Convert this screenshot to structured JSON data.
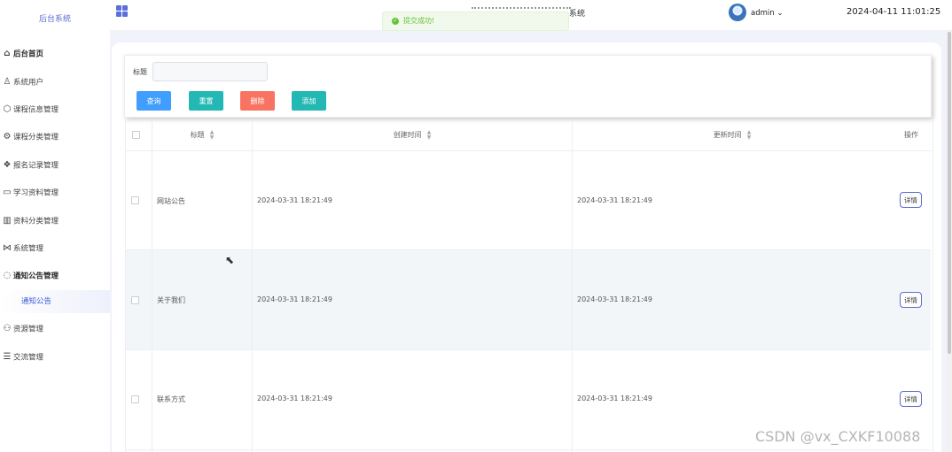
{
  "sidebar": {
    "brand": "后台系统",
    "items": [
      {
        "label": "后台首页",
        "icon": "home-icon",
        "glyph": "⌂"
      },
      {
        "label": "系统用户",
        "icon": "user-icon",
        "glyph": "♙"
      },
      {
        "label": "课程信息管理",
        "icon": "cube-icon",
        "glyph": "⬡"
      },
      {
        "label": "课程分类管理",
        "icon": "gear-icon",
        "glyph": "⚙"
      },
      {
        "label": "报名记录管理",
        "icon": "apps-icon",
        "glyph": "❖"
      },
      {
        "label": "学习资料管理",
        "icon": "briefcase-icon",
        "glyph": "▭"
      },
      {
        "label": "资料分类管理",
        "icon": "book-icon",
        "glyph": "▥"
      },
      {
        "label": "系统管理",
        "icon": "share-icon",
        "glyph": "⋈"
      },
      {
        "label": "通知公告管理",
        "icon": "chat-icon",
        "glyph": "◌"
      },
      {
        "label": "资源管理",
        "icon": "users-icon",
        "glyph": "⚇"
      },
      {
        "label": "交流管理",
        "icon": "list-icon",
        "glyph": "☰"
      }
    ],
    "active_sub": "通知公告"
  },
  "header": {
    "title_suffix": "系统",
    "username": "admin",
    "datetime": "2024-04-11 11:01:25"
  },
  "toast": {
    "message": "提交成功!"
  },
  "search": {
    "label": "标题",
    "value": "",
    "placeholder": "",
    "buttons": {
      "query": "查询",
      "reset": "重置",
      "delete": "删除",
      "add": "添加"
    }
  },
  "table": {
    "columns": {
      "title": "标题",
      "created": "创建时间",
      "updated": "更新时间",
      "actions": "操作"
    },
    "rows": [
      {
        "title": "网站公告",
        "created": "2024-03-31 18:21:49",
        "updated": "2024-03-31 18:21:49",
        "action": "详情"
      },
      {
        "title": "关于我们",
        "created": "2024-03-31 18:21:49",
        "updated": "2024-03-31 18:21:49",
        "action": "详情"
      },
      {
        "title": "联系方式",
        "created": "2024-03-31 18:21:49",
        "updated": "2024-03-31 18:21:49",
        "action": "详情"
      }
    ]
  },
  "watermark": "CSDN @vx_CXKF10088",
  "colors": {
    "accent": "#5c6ad0",
    "query": "#409eff",
    "reset": "#23b8b3",
    "delete": "#f97363",
    "success": "#67c23a"
  }
}
